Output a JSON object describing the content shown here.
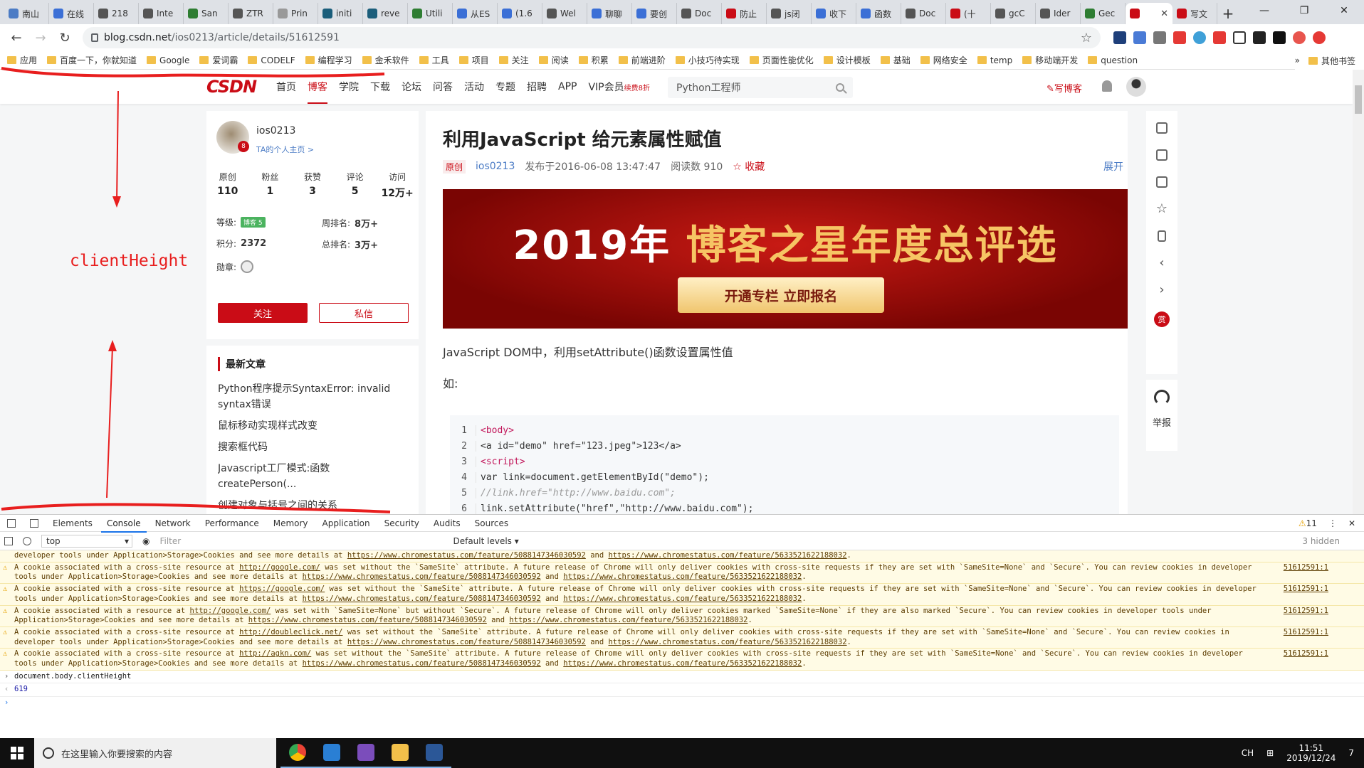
{
  "browser": {
    "tabs": [
      {
        "label": "南山",
        "color": "#4c7cc5"
      },
      {
        "label": "在线",
        "color": "#3b6fd6"
      },
      {
        "label": "218",
        "color": "#555555"
      },
      {
        "label": "Inte",
        "color": "#555555"
      },
      {
        "label": "San",
        "color": "#2e7d32"
      },
      {
        "label": "ZTR",
        "color": "#555555"
      },
      {
        "label": "Prin",
        "color": "#999999"
      },
      {
        "label": "initi",
        "color": "#1b5e7b"
      },
      {
        "label": "reve",
        "color": "#1b5e7b"
      },
      {
        "label": "Utili",
        "color": "#2e7d32"
      },
      {
        "label": "从ES",
        "color": "#3b6fd6"
      },
      {
        "label": "(1.6",
        "color": "#3b6fd6"
      },
      {
        "label": "Wel",
        "color": "#555555"
      },
      {
        "label": "聊聊",
        "color": "#3b6fd6"
      },
      {
        "label": "要创",
        "color": "#3b6fd6"
      },
      {
        "label": "Doc",
        "color": "#555555"
      },
      {
        "label": "防止",
        "color": "#ca0c16"
      },
      {
        "label": "js闭",
        "color": "#555555"
      },
      {
        "label": "收下",
        "color": "#3b6fd6"
      },
      {
        "label": "函数",
        "color": "#3b6fd6"
      },
      {
        "label": "Doc",
        "color": "#555555"
      },
      {
        "label": "(十",
        "color": "#ca0c16"
      },
      {
        "label": "gcC",
        "color": "#555555"
      },
      {
        "label": "Ider",
        "color": "#555555"
      },
      {
        "label": "Gec",
        "color": "#2e7d32"
      }
    ],
    "active_tab": {
      "label": "",
      "close": "✕"
    },
    "tab_after": {
      "label": "写文"
    },
    "new_tab": "+",
    "url_host": "blog.csdn.net",
    "url_path": "/ios0213/article/details/51612591",
    "bookmarks": [
      "应用",
      "百度一下，你就知道",
      "Google",
      "爱词霸",
      "CODELF",
      "编程学习",
      "金禾软件",
      "工具",
      "项目",
      "关注",
      "阅读",
      "积累",
      "前端进阶",
      "小技巧待实现",
      "页面性能优化",
      "设计模板",
      "基础",
      "网络安全",
      "temp",
      "移动端开发",
      "question"
    ],
    "bookmarks_more": "»",
    "bookmarks_other": "其他书签"
  },
  "csdn": {
    "logo": "CSDN",
    "nav": [
      "首页",
      "博客",
      "学院",
      "下载",
      "论坛",
      "问答",
      "活动",
      "专题",
      "招聘",
      "APP"
    ],
    "vip": "VIP会员",
    "vip_sub": "续费8折",
    "search": "Python工程师",
    "write_blog": "写博客"
  },
  "profile": {
    "name": "ios0213",
    "home": "TA的个人主页 >",
    "badge": "8",
    "stats": [
      {
        "key": "原创",
        "value": "110"
      },
      {
        "key": "粉丝",
        "value": "1"
      },
      {
        "key": "获赞",
        "value": "3"
      },
      {
        "key": "评论",
        "value": "5"
      },
      {
        "key": "访问",
        "value": "12万+"
      }
    ],
    "level_label": "等级:",
    "level_badge": "博客 5",
    "week_rank_label": "周排名:",
    "week_rank": "8万+",
    "points_label": "积分:",
    "points": "2372",
    "total_rank_label": "总排名:",
    "total_rank": "3万+",
    "medal_label": "勋章:",
    "follow": "关注",
    "message": "私信"
  },
  "recent": {
    "heading": "最新文章",
    "items": [
      "Python程序提示SyntaxError: invalid syntax错误",
      "鼠标移动实现样式改变",
      "搜索框代码",
      "Javascript工厂模式:函数createPerson(...",
      "创建对象与括号之间的关系"
    ]
  },
  "article": {
    "title": "利用JavaScript 给元素属性赋值",
    "tag": "原创",
    "author": "ios0213",
    "published": "发布于2016-06-08 13:47:47",
    "reads": "阅读数 910",
    "collect": "☆ 收藏",
    "expand": "展开",
    "banner_year": "2019年",
    "banner_title": "博客之星年度总评选",
    "banner_cta": "开通专栏 立即报名",
    "para1": "JavaScript DOM中，利用setAttribute()函数设置属性值",
    "para2": "如:",
    "code": [
      {
        "n": "1",
        "t": "<body>"
      },
      {
        "n": "2",
        "t": "<a id=\"demo\" href=\"123.jpeg\">123</a>"
      },
      {
        "n": "3",
        "t": "<script>"
      },
      {
        "n": "4",
        "t": "var link=document.getElementById(\"demo\");"
      },
      {
        "n": "5",
        "t": "//link.href=\"http://www.baidu.com\";"
      },
      {
        "n": "6",
        "t": "link.setAttribute(\"href\",\"http://www.baidu.com\");"
      }
    ]
  },
  "sidebar_tools": {
    "reward": "赏",
    "report": "举报"
  },
  "devtools": {
    "tabs": [
      "Elements",
      "Console",
      "Network",
      "Performance",
      "Memory",
      "Application",
      "Security",
      "Audits",
      "Sources"
    ],
    "warn_count": "11",
    "context": "top",
    "filter_placeholder": "Filter",
    "levels": "Default levels ▾",
    "hidden": "3 hidden",
    "link_a": "https://www.chromestatus.com/feature/5088147346030592",
    "link_b": "https://www.chromestatus.com/feature/5633521622188032",
    "source": "51612591:1",
    "and": "and",
    "see_more": "developer tools under Application>Storage>Cookies and see more details at",
    "warnings": [
      {
        "a": "A cookie associated with a cross-site resource at",
        "site": "http://google.com/",
        "b": "was set without the `SameSite` attribute. A future release of Chrome will only deliver cookies with cross-site requests if they are set with `SameSite=None` and `Secure`. You can review cookies in"
      },
      {
        "a": "A cookie associated with a cross-site resource at",
        "site": "https://google.com/",
        "b": "was set without the `SameSite` attribute. A future release of Chrome will only deliver cookies with cross-site requests if they are set with `SameSite=None` and `Secure`. You can review cookies in"
      },
      {
        "a": "A cookie associated with a resource at",
        "site": "http://google.com/",
        "b": "was set with `SameSite=None` but without `Secure`. A future release of Chrome will only deliver cookies marked `SameSite=None` if they are also marked `Secure`. You can review cookies in developer tools under Application>Storage>Cookies and see more details at"
      },
      {
        "a": "A cookie associated with a cross-site resource at",
        "site": "http://doubleclick.net/",
        "b": "was set without the `SameSite` attribute. A future release of Chrome will only deliver cookies with cross-site requests if they are set with `SameSite=None` and `Secure`. You can review cookies in developer tools under Application>Storage>Cookies and see more details at"
      },
      {
        "a": "A cookie associated with a cross-site resource at",
        "site": "http://agkn.com/",
        "b": "was set without the `SameSite` attribute. A future release of Chrome will only deliver cookies with cross-site requests if they are set with `SameSite=None` and `Secure`. You can review cookies in"
      }
    ],
    "command": "document.body.clientHeight",
    "result": "619"
  },
  "taskbar": {
    "search": "在这里输入你要搜索的内容",
    "lang": "CH",
    "ime": "⊞",
    "time": "11:51",
    "date": "2019/12/24",
    "notify": "7"
  },
  "annotation": {
    "label": "clientHeight"
  },
  "colors": {
    "brand": "#ca0c16",
    "link": "#4c7cc5",
    "warn_bg": "#fffbe5",
    "annotation": "#e81e1e"
  }
}
